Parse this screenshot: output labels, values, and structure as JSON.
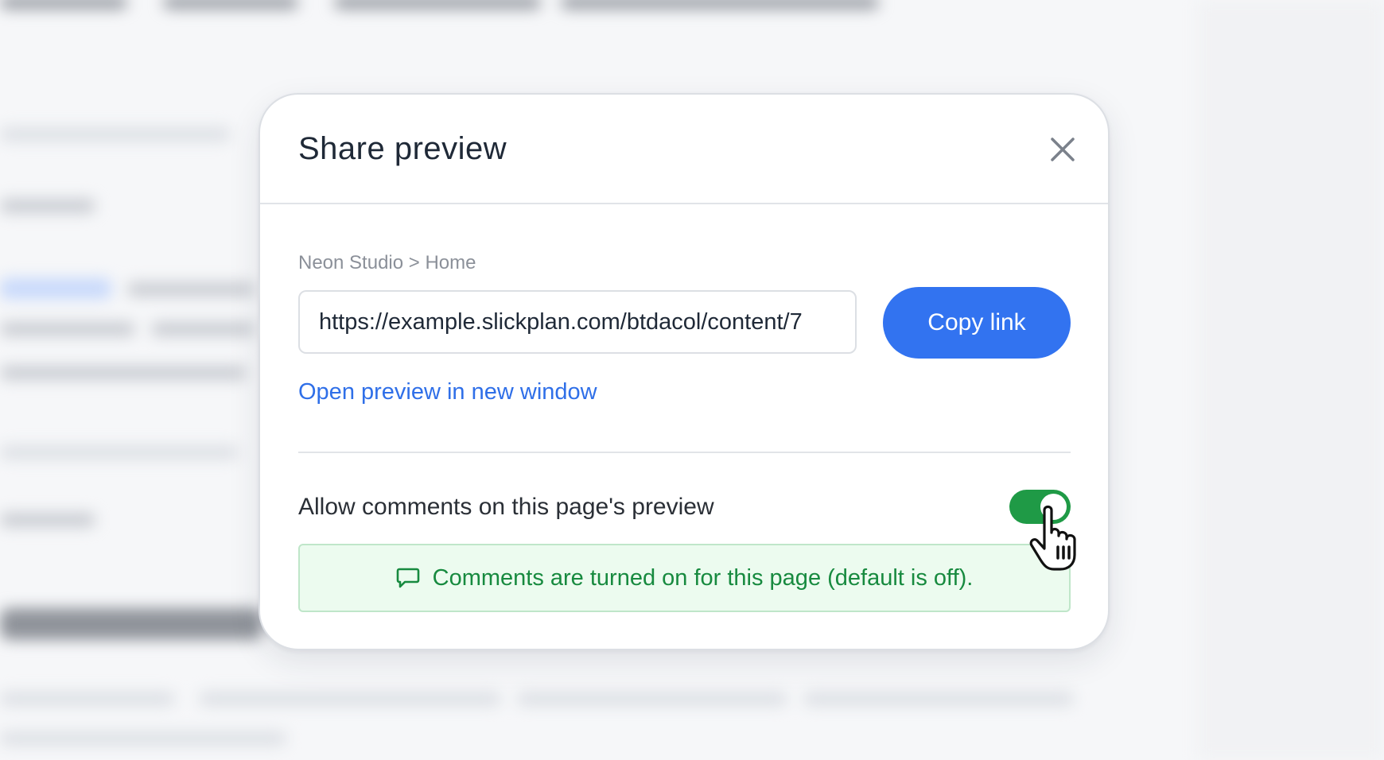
{
  "modal": {
    "title": "Share preview",
    "breadcrumb": "Neon Studio > Home",
    "url_value": "https://example.slickplan.com/btdacol/content/7",
    "copy_button": "Copy link",
    "open_link": "Open preview in new window",
    "allow_comments_label": "Allow comments on this page's preview",
    "allow_comments_enabled": true,
    "notice_text": "Comments are turned on for this page (default is off)."
  },
  "icons": {
    "close": "close-icon",
    "comment": "comment-icon",
    "cursor": "hand-pointer-cursor"
  },
  "colors": {
    "primary": "#3273f0",
    "link": "#2f6fe8",
    "toggle_on": "#1f9a46",
    "notice_bg": "#ecfbef",
    "notice_text": "#178a3f"
  }
}
